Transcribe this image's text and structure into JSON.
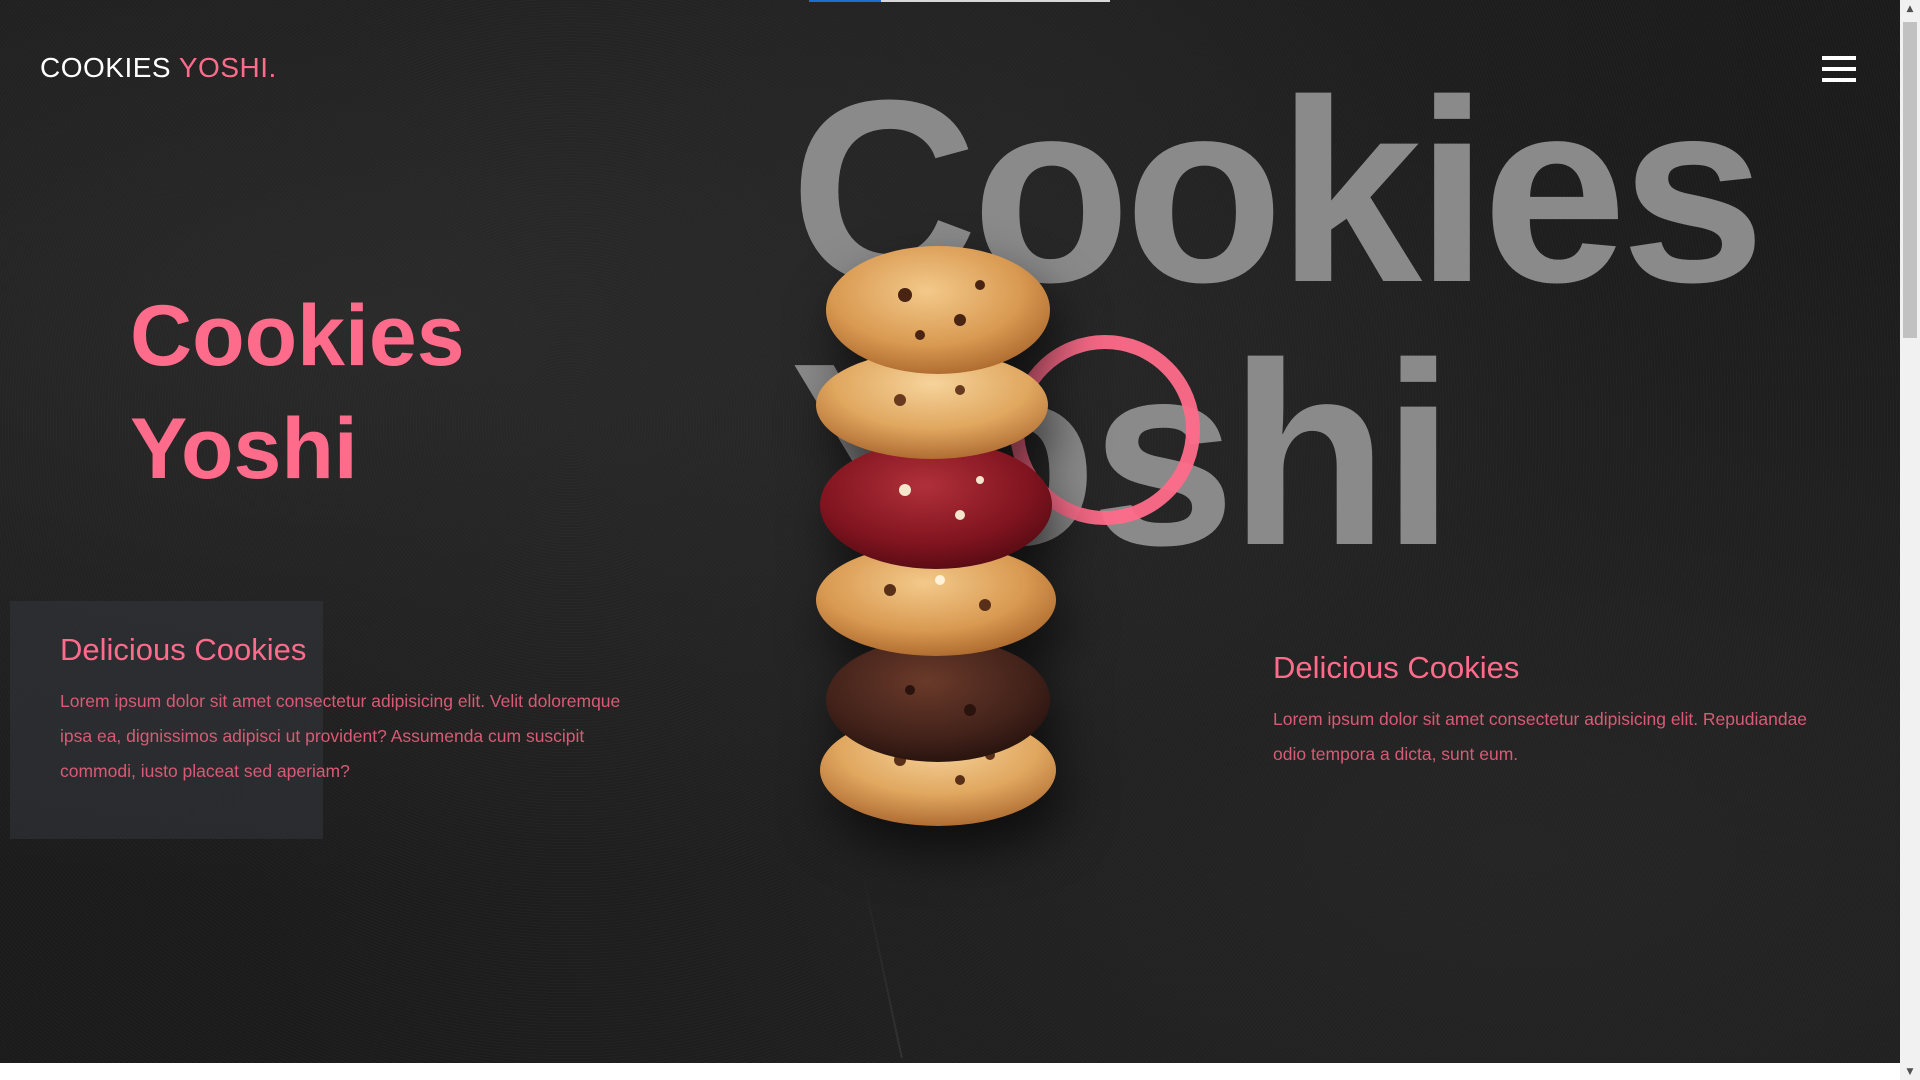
{
  "header": {
    "brand_main": "COOKIES",
    "brand_accent": "YOSHI."
  },
  "hero": {
    "title_line1": "Cookies",
    "title_line2": "Yoshi",
    "background_line1": "Cookies",
    "background_line2": "Yoshi"
  },
  "left_info": {
    "heading": "Delicious Cookies",
    "body": "Lorem ipsum dolor sit amet consectetur adipisicing elit. Velit doloremque ipsa ea, dignissimos adipisci ut provident? Assumenda cum suscipit commodi, iusto placeat sed aperiam?"
  },
  "right_info": {
    "heading": "Delicious Cookies",
    "body": "Lorem ipsum dolor sit amet consectetur adipisicing elit. Repudiandae odio tempora a dicta, sunt eum."
  },
  "icons": {
    "menu": "hamburger-menu-icon",
    "scroll_up": "scroll-up-arrow-icon",
    "scroll_down": "scroll-down-arrow-icon"
  },
  "colors": {
    "accent": "#ff6b8a",
    "background": "#1b1b1b",
    "background_word": "#8a8a8a",
    "progress_fill": "#1a6fd1"
  },
  "progress": {
    "fraction": 0.24
  }
}
